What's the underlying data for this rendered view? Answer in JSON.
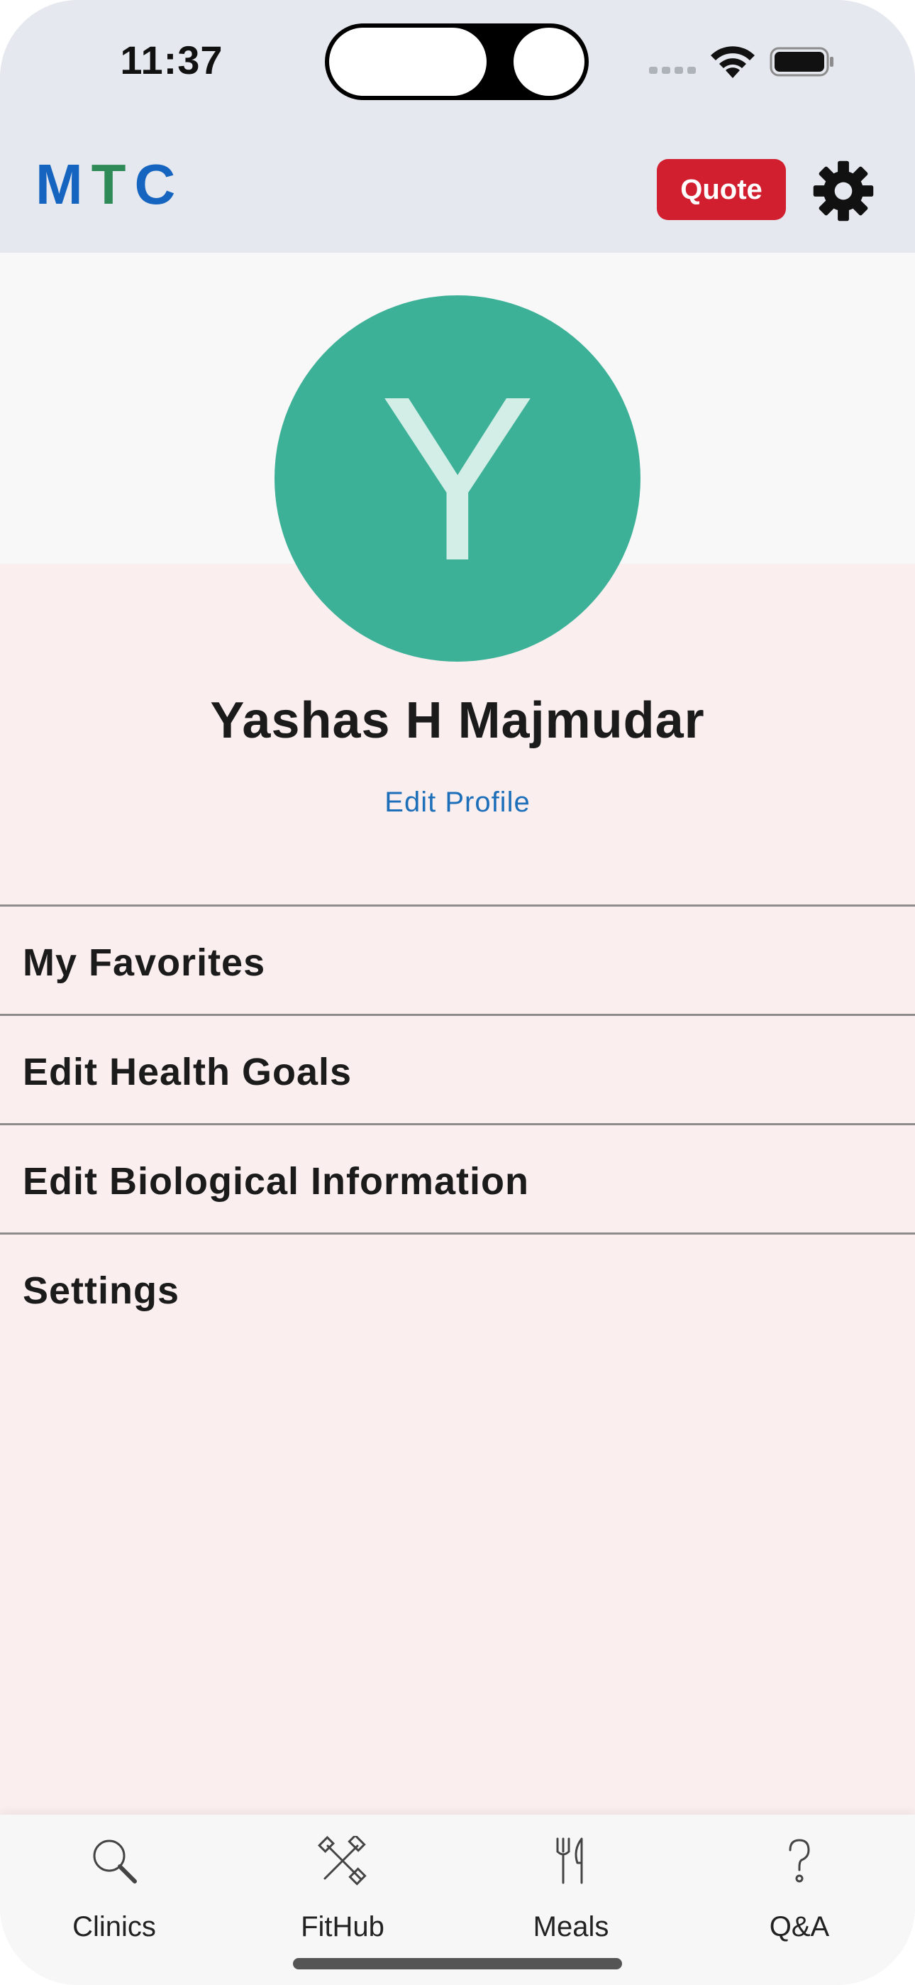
{
  "status_bar": {
    "time": "11:37"
  },
  "header": {
    "logo": {
      "m": "M",
      "t": "T",
      "c": "C"
    },
    "quote_label": "Quote",
    "settings_icon": "gear-icon"
  },
  "profile": {
    "avatar_letter": "Y",
    "name": "Yashas H Majmudar",
    "edit_label": "Edit Profile"
  },
  "menu": {
    "items": [
      {
        "label": "My Favorites"
      },
      {
        "label": "Edit Health Goals"
      },
      {
        "label": "Edit Biological Information"
      },
      {
        "label": "Settings"
      }
    ]
  },
  "tabs": [
    {
      "label": "Clinics",
      "icon": "search-icon"
    },
    {
      "label": "FitHub",
      "icon": "fitness-tools-icon"
    },
    {
      "label": "Meals",
      "icon": "fork-knife-icon"
    },
    {
      "label": "Q&A",
      "icon": "question-icon"
    }
  ],
  "colors": {
    "brand_blue": "#1565c0",
    "brand_green": "#2e8b57",
    "quote_red": "#d21f30",
    "avatar_green": "#3cb197",
    "link_blue": "#1d6fba",
    "page_background": "#fbeeee",
    "header_background": "#e5e8ef"
  }
}
